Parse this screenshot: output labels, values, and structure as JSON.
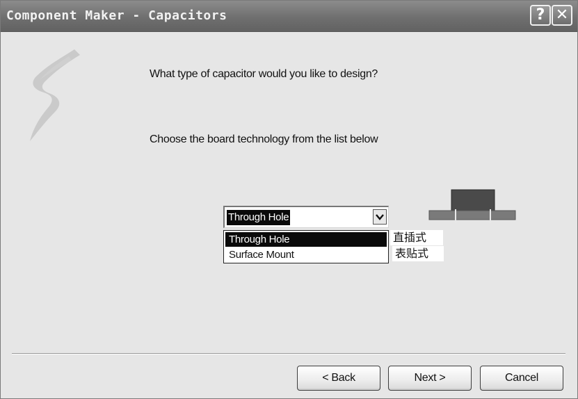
{
  "window": {
    "title": "Component Maker - Capacitors",
    "help_glyph": "?",
    "close_glyph": "✕"
  },
  "content": {
    "question": "What type of capacitor would you like to design?",
    "instruction": "Choose the board technology from the list below"
  },
  "technology_combo": {
    "selected_value": "Through Hole",
    "options": [
      {
        "label": "Through Hole",
        "note": "直插式"
      },
      {
        "label": "Surface Mount",
        "note": "表贴式"
      }
    ]
  },
  "icons": {
    "logo": "wizard-logo-icon",
    "dropdown_arrow": "chevron-down-icon",
    "component_preview": "through-hole-capacitor-icon"
  },
  "colors": {
    "titlebar": "#6f6f6f",
    "selection": "#0a0a0a",
    "component_body": "#4a4a4a",
    "board": "#7a7a7a"
  },
  "buttons": {
    "back": "< Back",
    "next": "Next >",
    "cancel": "Cancel"
  }
}
